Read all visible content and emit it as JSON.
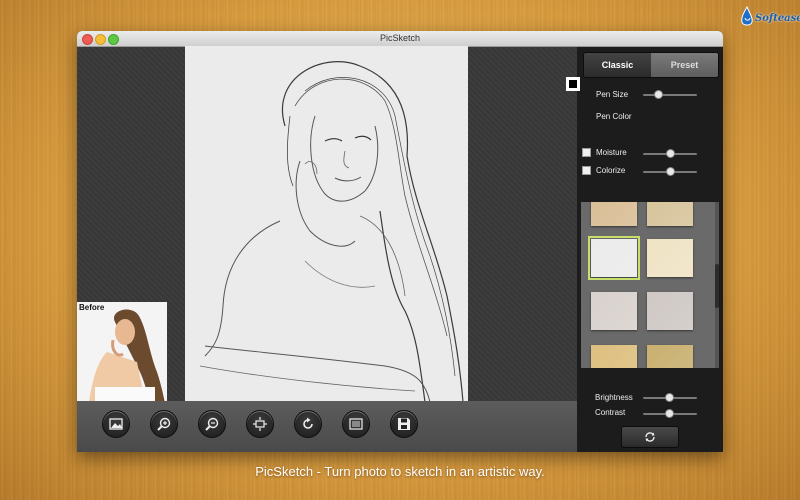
{
  "window": {
    "title": "PicSketch"
  },
  "brand": {
    "logo_text": "Softease"
  },
  "canvas": {
    "before_label": "Before"
  },
  "toolbar": {
    "buttons": [
      {
        "name": "open-image",
        "icon": "image-icon"
      },
      {
        "name": "zoom-in",
        "icon": "zoom-in-icon"
      },
      {
        "name": "zoom-out",
        "icon": "zoom-out-icon"
      },
      {
        "name": "fit",
        "icon": "fit-screen-icon"
      },
      {
        "name": "rotate",
        "icon": "rotate-icon"
      },
      {
        "name": "frame",
        "icon": "frame-icon"
      },
      {
        "name": "save",
        "icon": "save-icon"
      }
    ]
  },
  "panel": {
    "tabs": {
      "classic": "Classic",
      "preset": "Preset",
      "active": "Classic"
    },
    "pen_size": {
      "label": "Pen Size",
      "value": 0.3
    },
    "pen_color": {
      "label": "Pen Color",
      "color": "#000000"
    },
    "moisture": {
      "label": "Moisture",
      "checked": false,
      "value": 0.5
    },
    "colorize": {
      "label": "Colorize",
      "checked": false,
      "value": 0.5
    },
    "textures": {
      "selected_index": 2,
      "colors": [
        "#d8bd94",
        "#d6c39a",
        "#ebebeb",
        "#efe3c4",
        "#d8d1cd",
        "#cfc8c5",
        "#ddbf7e",
        "#c9b070"
      ]
    },
    "brightness": {
      "label": "Brightness",
      "value": 0.5
    },
    "contrast": {
      "label": "Contrast",
      "value": 0.5
    },
    "reset_icon": "refresh-icon"
  },
  "caption": "PicSketch - Turn photo to sketch in an artistic way."
}
